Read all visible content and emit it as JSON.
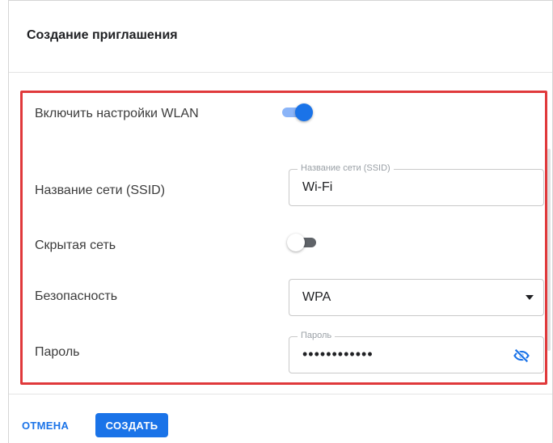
{
  "dialog": {
    "title": "Создание приглашения"
  },
  "wlan": {
    "enable_label": "Включить настройки WLAN",
    "enable_on": true
  },
  "ssid": {
    "label": "Название сети (SSID)",
    "field_legend": "Название сети (SSID)",
    "value": "Wi-Fi"
  },
  "hidden": {
    "label": "Скрытая сеть",
    "on": false
  },
  "security": {
    "label": "Безопасность",
    "value": "WPA"
  },
  "password": {
    "label": "Пароль",
    "field_legend": "Пароль",
    "value": "••••••••••••",
    "visibility_icon": "eye-off-icon"
  },
  "footer": {
    "cancel_label": "ОТМЕНА",
    "create_label": "СОЗДАТЬ"
  },
  "colors": {
    "accent": "#1a73e8",
    "highlight": "#e0393b"
  }
}
